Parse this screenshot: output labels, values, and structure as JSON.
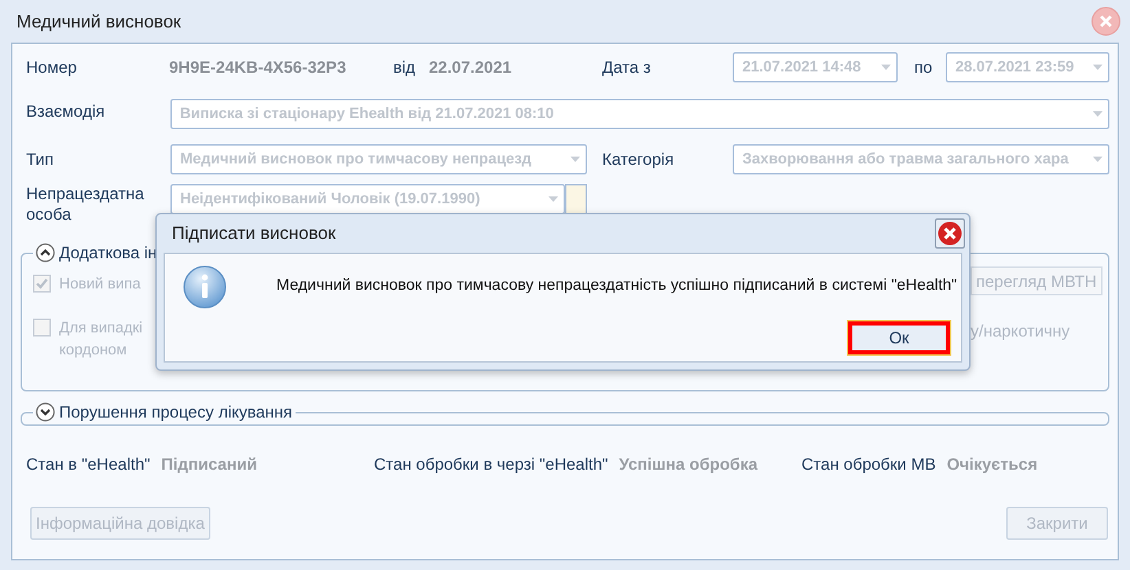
{
  "window": {
    "title": "Медичний висновок"
  },
  "header": {
    "number_label": "Номер",
    "number": "9H9E-24KB-4X56-32P3",
    "date_label": "від",
    "date": "22.07.2021",
    "from_label": "Дата з",
    "from": "21.07.2021 14:48",
    "to_label": "по",
    "to": "28.07.2021 23:59"
  },
  "interaction": {
    "label": "Взаємодія",
    "value": "Виписка зі стаціонару Ehealth від 21.07.2021 08:10"
  },
  "type": {
    "label": "Тип",
    "value": "Медичний висновок про тимчасову непрацезд"
  },
  "category": {
    "label": "Категорія",
    "value": "Захворювання або травма загального хара"
  },
  "person": {
    "label": "Непрацездатна особа",
    "value": "Неідентифікований Чоловік (19.07.1990)"
  },
  "extra_group": {
    "title": "Додаткова ін",
    "expanded": true,
    "checkboxes": [
      {
        "label": "Новий випа",
        "checked": true
      },
      {
        "label": "Для випадкі кордоном",
        "checked": false
      }
    ],
    "view_button": "перегляд МВТН",
    "note": "у/наркотичну"
  },
  "violation_group": {
    "title": "Порушення процесу лікування",
    "expanded": false
  },
  "statuses": [
    {
      "label": "Стан в \"eHealth\"",
      "value": "Підписаний"
    },
    {
      "label": "Стан обробки в черзі \"eHealth\"",
      "value": "Успішна обробка"
    },
    {
      "label": "Стан обробки МВ",
      "value": "Очікується"
    }
  ],
  "buttons": {
    "info": "Інформаційна довідка",
    "close": "Закрити"
  },
  "dialog": {
    "title": "Підписати висновок",
    "message": "Медичний висновок про тимчасову непрацездатність успішно підписаний в системі \"eHealth\"",
    "ok": "Ок",
    "ok_highlighted": true
  }
}
